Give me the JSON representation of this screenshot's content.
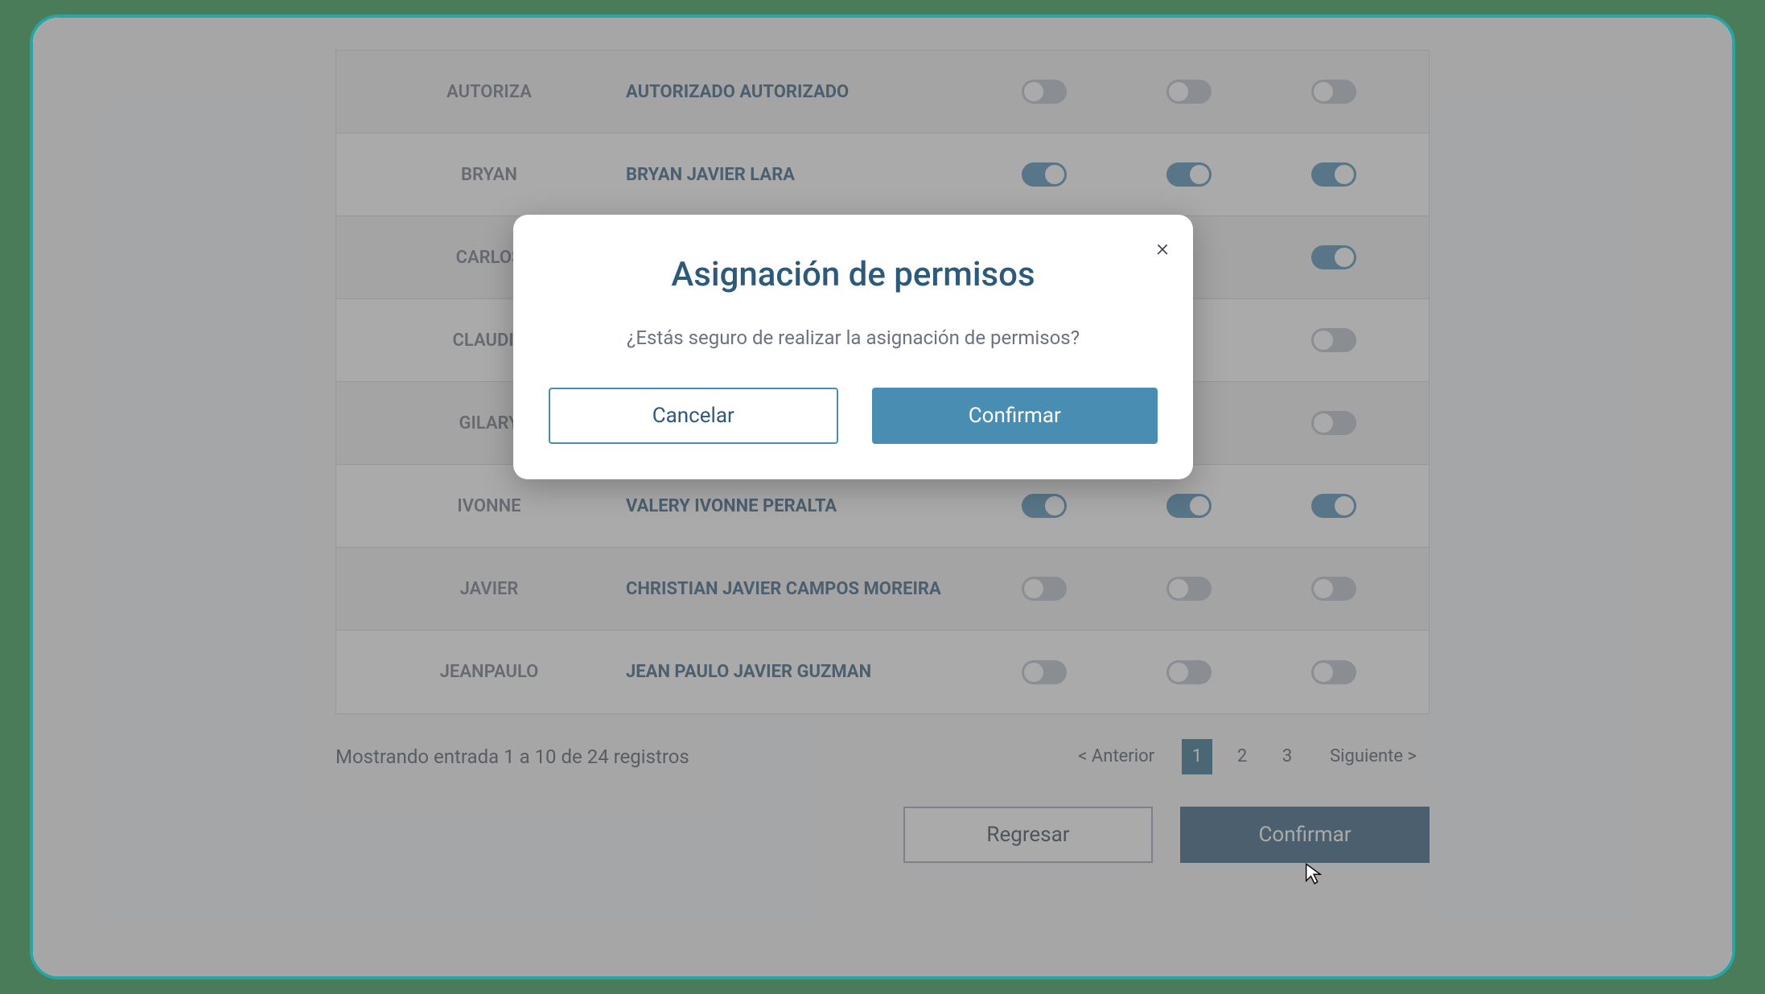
{
  "modal": {
    "title": "Asignación de permisos",
    "message": "¿Estás seguro de realizar la asignación de permisos?",
    "cancel": "Cancelar",
    "confirm": "Confirmar",
    "close": "×"
  },
  "table": {
    "rows": [
      {
        "user": "AUTORIZA",
        "name": "AUTORIZADO AUTORIZADO",
        "t1": false,
        "t2": false,
        "t3": false
      },
      {
        "user": "BRYAN",
        "name": "BRYAN JAVIER LARA",
        "t1": true,
        "t2": true,
        "t3": true
      },
      {
        "user": "CARLOS",
        "name": "",
        "t1": null,
        "t2": null,
        "t3": true
      },
      {
        "user": "CLAUDIA",
        "name": "",
        "t1": null,
        "t2": null,
        "t3": false
      },
      {
        "user": "GILARY",
        "name": "",
        "t1": null,
        "t2": null,
        "t3": false
      },
      {
        "user": "IVONNE",
        "name": "VALERY IVONNE PERALTA",
        "t1": true,
        "t2": true,
        "t3": true
      },
      {
        "user": "JAVIER",
        "name": "CHRISTIAN JAVIER CAMPOS MOREIRA",
        "t1": false,
        "t2": false,
        "t3": false
      },
      {
        "user": "JEANPAULO",
        "name": "JEAN PAULO JAVIER GUZMAN",
        "t1": false,
        "t2": false,
        "t3": false
      }
    ]
  },
  "footer": {
    "records": "Mostrando entrada 1 a 10 de 24 registros",
    "prev": "< Anterior",
    "next": "Siguiente >",
    "pages": [
      "1",
      "2",
      "3"
    ],
    "active_page": "1"
  },
  "actions": {
    "back": "Regresar",
    "confirm": "Confirmar"
  }
}
